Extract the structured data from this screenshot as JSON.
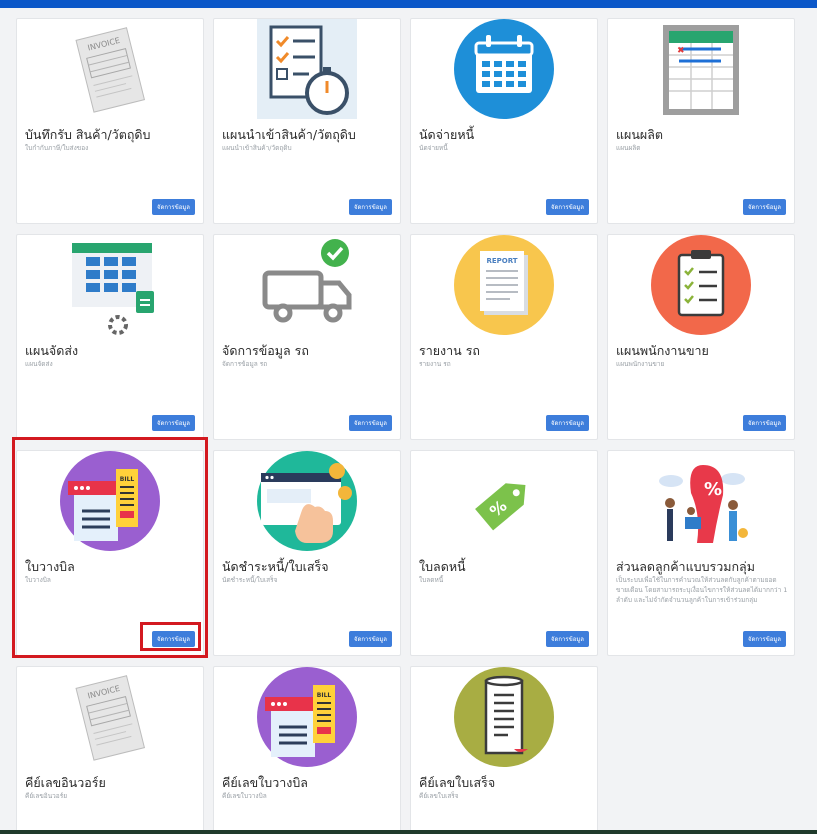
{
  "theme": {
    "accent": "#0b57c8",
    "button": "#3d7ddb",
    "highlight": "#d31920"
  },
  "cards": [
    {
      "title": "บันทึกรับ สินค้า/วัตถุดิบ",
      "subtitle": "ใบกำกับภาษี/ใบส่งของ",
      "button": "จัดการข้อมูล",
      "icon": "invoice-icon"
    },
    {
      "title": "แผนนำเข้าสินค้า/วัตถุดิบ",
      "subtitle": "แผนนำเข้าสินค้า/วัตถุดิบ",
      "button": "จัดการข้อมูล",
      "icon": "checklist-stopwatch-icon"
    },
    {
      "title": "นัดจ่ายหนี้",
      "subtitle": "นัดจ่ายหนี้",
      "button": "จัดการข้อมูล",
      "icon": "calendar-icon"
    },
    {
      "title": "แผนผลิต",
      "subtitle": "แผนผลิต",
      "button": "จัดการข้อมูล",
      "icon": "spreadsheet-icon"
    },
    {
      "title": "แผนจัดส่ง",
      "subtitle": "แผนจัดส่ง",
      "button": "จัดการข้อมูล",
      "icon": "schedule-sheet-icon"
    },
    {
      "title": "จัดการข้อมูล รถ",
      "subtitle": "จัดการข้อมูล รถ",
      "button": "จัดการข้อมูล",
      "icon": "truck-icon"
    },
    {
      "title": "รายงาน รถ",
      "subtitle": "รายงาน รถ",
      "button": "จัดการข้อมูล",
      "icon": "report-icon"
    },
    {
      "title": "แผนพนักงานขาย",
      "subtitle": "แผนพนักงานขาย",
      "button": "จัดการข้อมูล",
      "icon": "clipboard-icon"
    },
    {
      "title": "ใบวางบิล",
      "subtitle": "ใบวางบิล",
      "button": "จัดการข้อมูล",
      "icon": "bill-icon"
    },
    {
      "title": "นัดชำระหนี้/ใบเสร็จ",
      "subtitle": "นัดชำระหนี้/ใบเสร็จ",
      "button": "จัดการข้อมูล",
      "icon": "online-payment-icon"
    },
    {
      "title": "ใบลดหนี้",
      "subtitle": "ใบลดหนี้",
      "button": "จัดการข้อมูล",
      "icon": "discount-tag-icon"
    },
    {
      "title": "ส่วนลดลูกค้าแบบรวมกลุ่ม",
      "subtitle": "เป็นระบบเพื่อใช้ในการคำนวณให้ส่วนลดกับลูกค้าตามยอดขายเดือน โดยสามารถระบุเงื่อนไขการให้ส่วนลดได้มากกว่า 1 ลำดับ และไม่จำกัดจำนวนลูกค้าในการเข้าร่วมกลุ่ม",
      "button": "จัดการข้อมูล",
      "icon": "group-discount-icon"
    },
    {
      "title": "คีย์เลขอินวอร์ย",
      "subtitle": "คีย์เลขอินวอร์ย",
      "button": "",
      "icon": "invoice-icon"
    },
    {
      "title": "คีย์เลขใบวางบิล",
      "subtitle": "คีย์เลขใบวางบิล",
      "button": "",
      "icon": "bill-icon"
    },
    {
      "title": "คีย์เลขใบเสร็จ",
      "subtitle": "คีย์เลขใบเสร็จ",
      "button": "",
      "icon": "receipt-icon"
    }
  ]
}
